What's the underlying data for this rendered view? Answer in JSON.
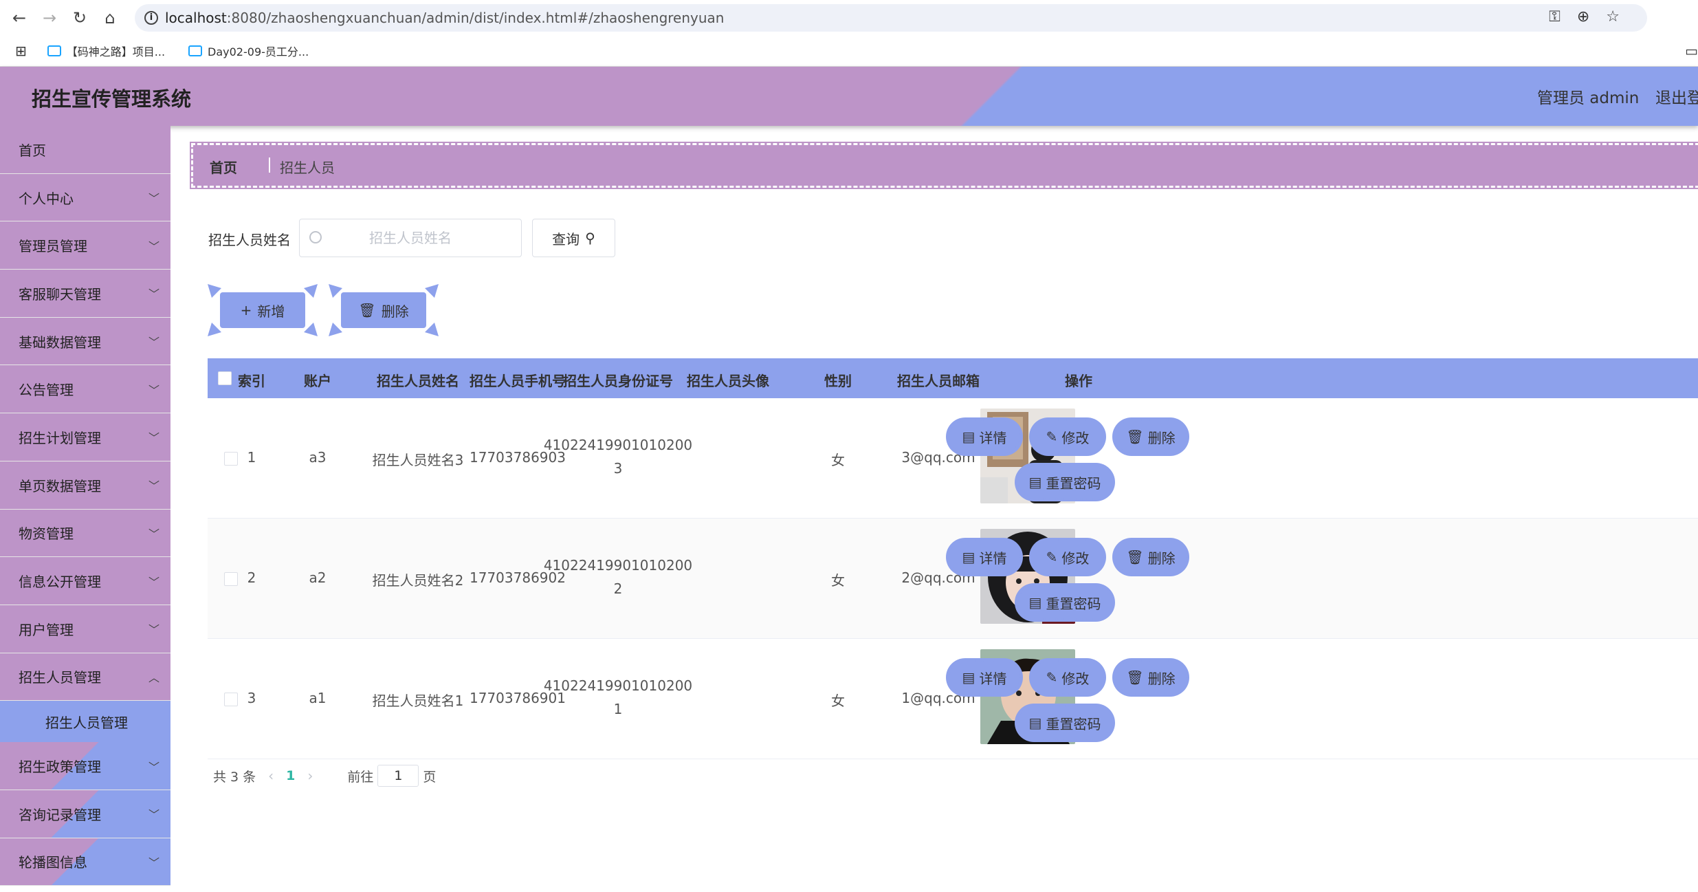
{
  "browser": {
    "url_host": "localhost",
    "url_path": ":8080/zhaoshengxuanchuan/admin/dist/index.html#/zhaoshengrenyuan",
    "bookmarks": [
      "【码神之路】项目...",
      "Day02-09-员工分..."
    ]
  },
  "header": {
    "title": "招生宣传管理系统",
    "user": "管理员 admin",
    "logout": "退出登录"
  },
  "sidebar": {
    "items": [
      {
        "label": "首页"
      },
      {
        "label": "个人中心"
      },
      {
        "label": "管理员管理"
      },
      {
        "label": "客服聊天管理"
      },
      {
        "label": "基础数据管理"
      },
      {
        "label": "公告管理"
      },
      {
        "label": "招生计划管理"
      },
      {
        "label": "单页数据管理"
      },
      {
        "label": "物资管理"
      },
      {
        "label": "信息公开管理"
      },
      {
        "label": "用户管理"
      },
      {
        "label": "招生人员管理"
      },
      {
        "label": "招生政策管理"
      },
      {
        "label": "咨询记录管理"
      },
      {
        "label": "轮播图信息"
      }
    ],
    "active_sub": "招生人员管理"
  },
  "breadcrumb": {
    "home": "首页",
    "current": "招生人员"
  },
  "search": {
    "label": "招生人员姓名",
    "placeholder": "招生人员姓名",
    "button": "查询"
  },
  "actions": {
    "add": "新增",
    "delete": "删除"
  },
  "table": {
    "headers": [
      "索引",
      "账户",
      "招生人员姓名",
      "招生人员手机号",
      "招生人员身份证号",
      "招生人员头像",
      "性别",
      "招生人员邮箱",
      "操作"
    ],
    "rows": [
      {
        "index": "1",
        "account": "a3",
        "name": "招生人员姓名3",
        "phone": "17703786903",
        "id_line1": "41022419901010200",
        "id_line2": "3",
        "gender": "女",
        "email": "3@qq.com"
      },
      {
        "index": "2",
        "account": "a2",
        "name": "招生人员姓名2",
        "phone": "17703786902",
        "id_line1": "41022419901010200",
        "id_line2": "2",
        "gender": "女",
        "email": "2@qq.com"
      },
      {
        "index": "3",
        "account": "a1",
        "name": "招生人员姓名1",
        "phone": "17703786901",
        "id_line1": "41022419901010200",
        "id_line2": "1",
        "gender": "女",
        "email": "1@qq.com"
      }
    ],
    "ops": {
      "detail": "详情",
      "edit": "修改",
      "delete": "删除",
      "reset": "重置密码"
    }
  },
  "pager": {
    "total": "共 3 条",
    "page": "1",
    "goto": "前往",
    "goto_value": "1",
    "page_unit": "页"
  },
  "colors": {
    "purple": "#bd94c8",
    "blue": "#8da1ec"
  }
}
